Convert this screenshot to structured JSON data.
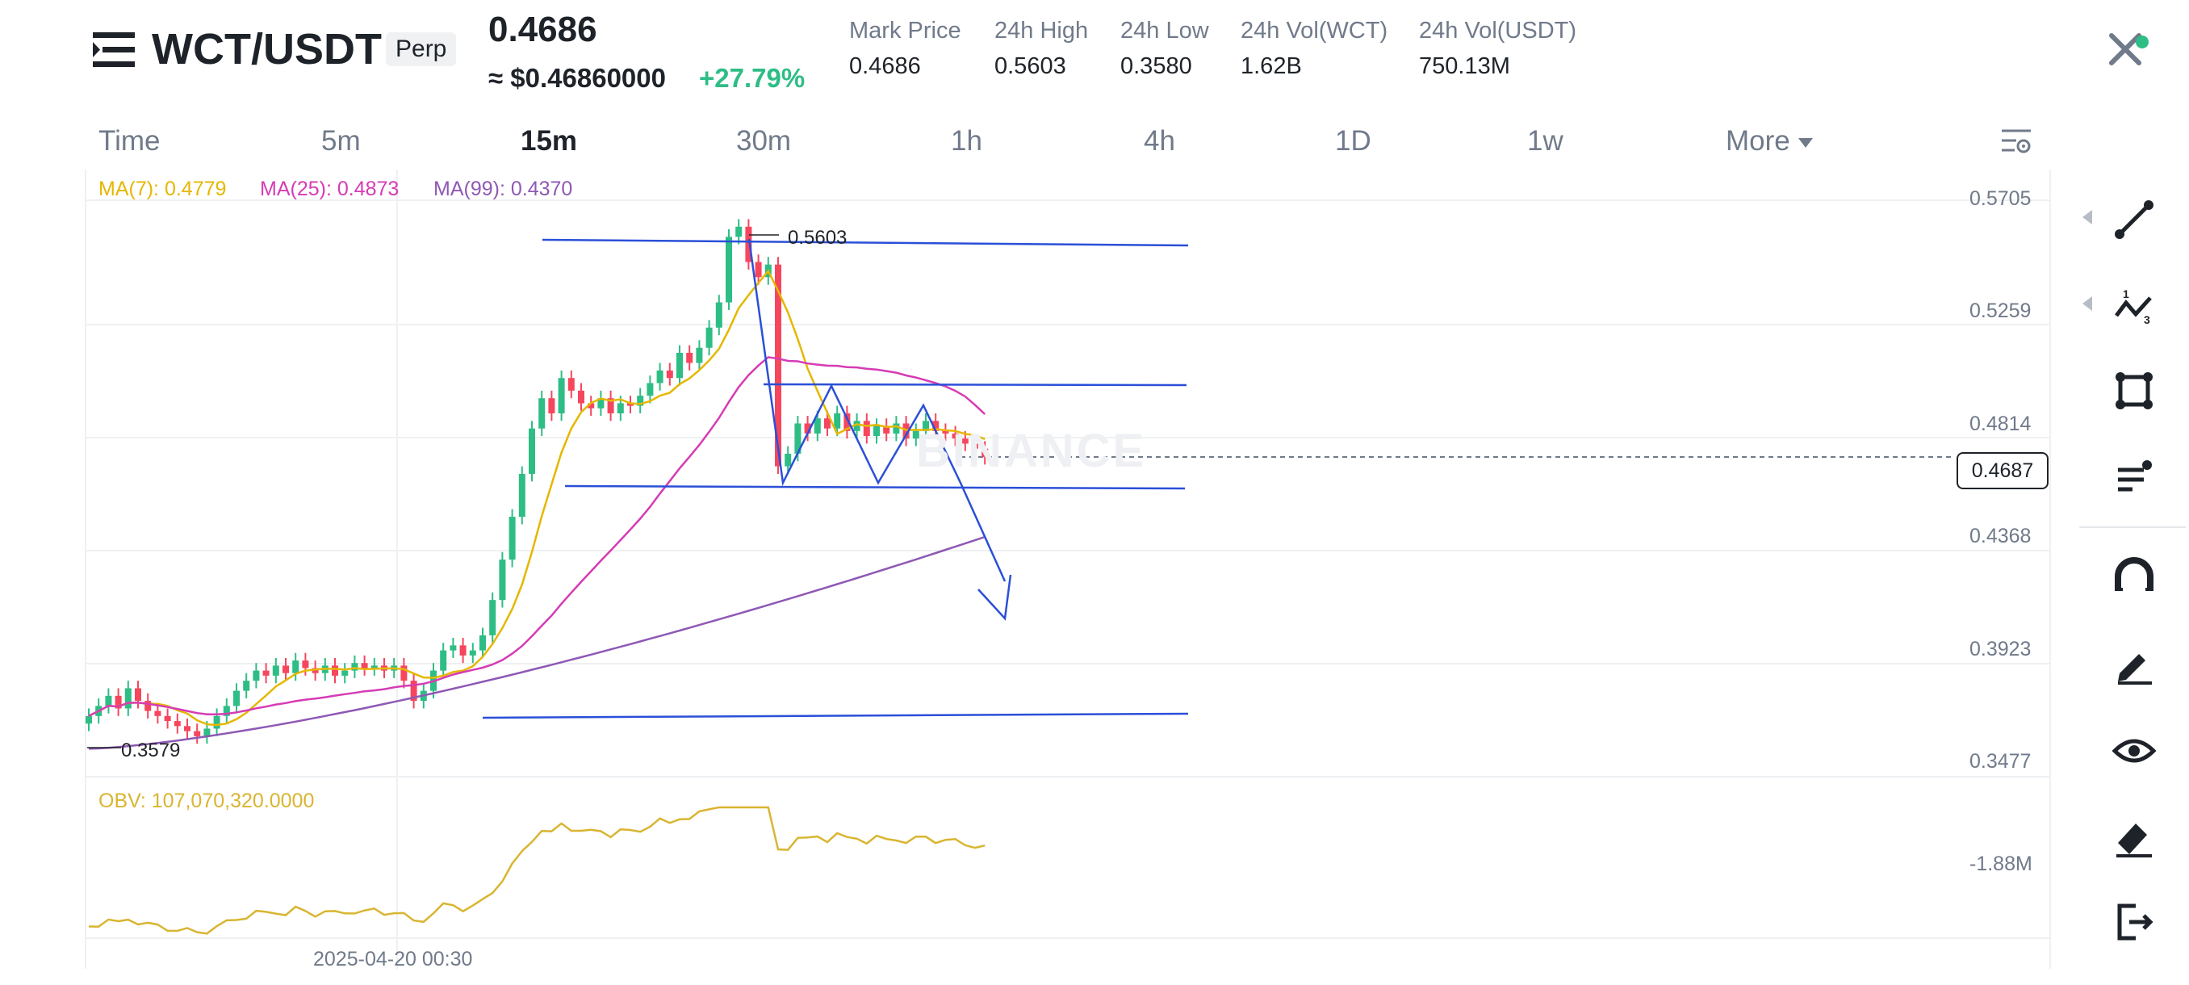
{
  "header": {
    "pair": "WCT/USDT",
    "contract_type": "Perp",
    "last_price": "0.4686",
    "usd_price": "≈ $0.46860000",
    "change_24h": "+27.79%",
    "stats": [
      {
        "label": "Mark Price",
        "value": "0.4686"
      },
      {
        "label": "24h High",
        "value": "0.5603"
      },
      {
        "label": "24h Low",
        "value": "0.3580"
      },
      {
        "label": "24h Vol(WCT)",
        "value": "1.62B"
      },
      {
        "label": "24h Vol(USDT)",
        "value": "750.13M"
      }
    ],
    "menu_icon": "hamburger-menu-icon",
    "close_icon": "close-icon"
  },
  "timeframes": {
    "items": [
      "Time",
      "5m",
      "15m",
      "30m",
      "1h",
      "4h",
      "1D",
      "1w",
      "More"
    ],
    "active": "15m",
    "settings_icon": "chart-settings-icon"
  },
  "indicators": {
    "ma7": "MA(7): 0.4779",
    "ma25": "MA(25): 0.4873",
    "ma99": "MA(99): 0.4370",
    "obv": "OBV: 107,070,320.0000",
    "obv_axis": "-1.88M"
  },
  "price_axis": [
    "0.5705",
    "0.5259",
    "0.4814",
    "0.4368",
    "0.3923",
    "0.3477"
  ],
  "current_price": "0.4687",
  "time_axis": "2025-04-20 00:30",
  "annotations": {
    "high": "0.5603",
    "low": "0.3579"
  },
  "watermark": "BINANCE",
  "colors": {
    "up": "#2ebd85",
    "down": "#f6465d",
    "ma7": "#e5b700",
    "ma25": "#d63bb5",
    "ma99": "#8e59b5",
    "drawing": "#2b4fd8",
    "obv": "#d9b531"
  },
  "toolbar": [
    "trend-line-icon",
    "fib-wave-icon",
    "rectangle-icon",
    "text-lines-icon",
    "magnet-icon",
    "pencil-icon",
    "eye-icon",
    "eraser-icon",
    "exit-icon"
  ],
  "chart_data": {
    "type": "candlestick",
    "interval": "15m",
    "ylim": [
      0.3477,
      0.5705
    ],
    "x_axis_label": "2025-04-20 00:30",
    "series": [
      {
        "name": "MA(7)",
        "last": 0.4779
      },
      {
        "name": "MA(25)",
        "last": 0.4873
      },
      {
        "name": "MA(99)",
        "last": 0.437
      }
    ],
    "close_prices": [
      0.366,
      0.37,
      0.374,
      0.369,
      0.377,
      0.372,
      0.368,
      0.366,
      0.364,
      0.362,
      0.36,
      0.358,
      0.361,
      0.366,
      0.37,
      0.376,
      0.38,
      0.384,
      0.382,
      0.386,
      0.383,
      0.388,
      0.385,
      0.383,
      0.386,
      0.382,
      0.384,
      0.387,
      0.385,
      0.386,
      0.384,
      0.386,
      0.38,
      0.372,
      0.376,
      0.384,
      0.392,
      0.394,
      0.39,
      0.392,
      0.398,
      0.412,
      0.428,
      0.445,
      0.462,
      0.48,
      0.492,
      0.486,
      0.5,
      0.495,
      0.49,
      0.488,
      0.492,
      0.486,
      0.49,
      0.489,
      0.493,
      0.498,
      0.503,
      0.5,
      0.51,
      0.506,
      0.512,
      0.52,
      0.53,
      0.556,
      0.56,
      0.546,
      0.54,
      0.545,
      0.465,
      0.47,
      0.482,
      0.478,
      0.484,
      0.48,
      0.486,
      0.479,
      0.483,
      0.477,
      0.481,
      0.478,
      0.482,
      0.476,
      0.479,
      0.483,
      0.479,
      0.478,
      0.476,
      0.474,
      0.472,
      0.4687
    ],
    "drawings": {
      "resistance_top": 0.5603,
      "channel_upper": 0.4982,
      "neckline": 0.4636,
      "support_bottom": 0.3579
    }
  }
}
